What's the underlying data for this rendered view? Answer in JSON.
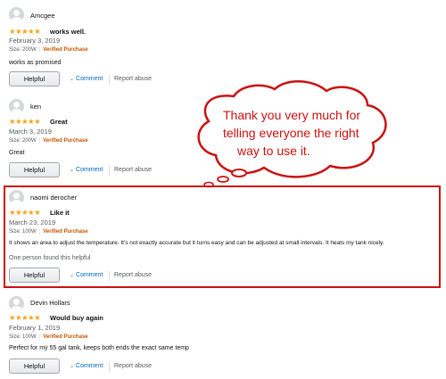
{
  "reviews": [
    {
      "name": "Amcgee",
      "stars": "★★★★★",
      "title": "works well.",
      "date": "February 3, 2019",
      "size": "Size: 200W",
      "verified": "Verified Purchase",
      "text": "works as promised",
      "helpful_label": "Helpful",
      "comment_label": "Comment",
      "report_label": "Report abuse"
    },
    {
      "name": "ken",
      "stars": "★★★★★",
      "title": "Great",
      "date": "March 3, 2019",
      "size": "Size: 200W",
      "verified": "Verified Purchase",
      "text": "Great",
      "helpful_label": "Helpful",
      "comment_label": "Comment",
      "report_label": "Report abuse"
    },
    {
      "name": "naomi derocher",
      "stars": "★★★★★",
      "title": "Like it",
      "date": "March 23, 2019",
      "size": "Size: 100W",
      "verified": "Verified Purchase",
      "text": "It shows an area to adjust the temperature. It's not exactly accurate but it turns easy and can be adjusted at small intervals. It heats my tank nicely.",
      "helpful_note": "One person found this helpful",
      "helpful_label": "Helpful",
      "comment_label": "Comment",
      "report_label": "Report abuse"
    },
    {
      "name": "Devin Hollars",
      "stars": "★★★★★",
      "title": "Would buy again",
      "date": "February 1, 2019",
      "size": "Size: 100W",
      "verified": "Verified Purchase",
      "text": "Perfect for my 55 gal tank, keeps both ends the exact same temp",
      "helpful_label": "Helpful",
      "comment_label": "Comment",
      "report_label": "Report abuse"
    }
  ],
  "annotation": {
    "lines": [
      "Thank you very much for",
      "telling everyone the right",
      "way to use it."
    ],
    "color": "#cc1111"
  },
  "colors": {
    "star": "#f4a41d",
    "verified": "#c45500",
    "link": "#0066c0",
    "highlight": "#cc1111"
  },
  "icons": {
    "avatar": "user-avatar-icon",
    "comment_chevron": "chevron-down-icon",
    "star": "star-icon"
  }
}
